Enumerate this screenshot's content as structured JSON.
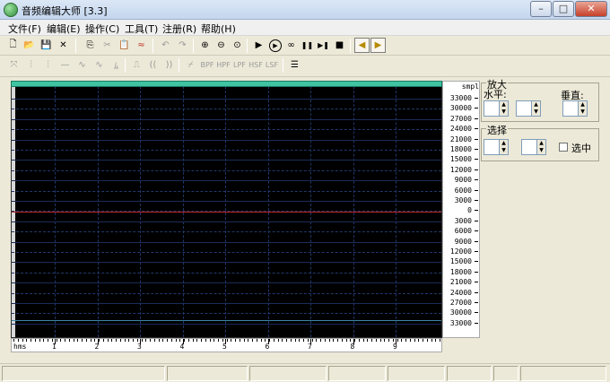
{
  "window": {
    "title": "音频编辑大师 [3.3]",
    "minimize": "–",
    "maximize": "□",
    "close": "✕"
  },
  "menu": {
    "items": [
      "文件(F)",
      "编辑(E)",
      "操作(C)",
      "工具(T)",
      "注册(R)",
      "帮助(H)"
    ]
  },
  "toolbar1": {
    "new": "🗋",
    "open": "📂",
    "save": "💾",
    "close": "✕",
    "copy": "⎘",
    "cut": "✂",
    "paste": "📋",
    "mix": "≈",
    "undo": "↶",
    "redo": "↷",
    "zoom_in": "⊕",
    "zoom_out": "⊖",
    "zoom_fit": "⊙",
    "play": "▶",
    "play_sel": "▶",
    "loop": "∞",
    "pause": "❚❚",
    "play_end": "▶❚",
    "stop": "■",
    "monitor_left": "◀",
    "monitor_right": "▶"
  },
  "toolbar2": {
    "fx": [
      "⤧",
      "⫶",
      "⫶",
      "—",
      "∿",
      "∿",
      "ﾑ",
      "⎍",
      "((",
      "))",
      "⌿"
    ],
    "filters": [
      "BPF",
      "HPF",
      "LPF",
      "HSF",
      "LSF"
    ],
    "settings_icon": "☰"
  },
  "waveform": {
    "yaxis_unit": "smpl",
    "yaxis_labels": [
      "33000",
      "30000",
      "27000",
      "24000",
      "21000",
      "18000",
      "15000",
      "12000",
      "9000",
      "6000",
      "3000",
      "0",
      "3000",
      "6000",
      "9000",
      "12000",
      "15000",
      "18000",
      "21000",
      "24000",
      "27000",
      "30000",
      "33000"
    ],
    "xaxis_unit": "hms",
    "xaxis_labels": [
      "1",
      "2",
      "3",
      "4",
      "5",
      "6",
      "7",
      "8",
      "9"
    ],
    "colors": {
      "background": "#000000",
      "center_line": "#c0252a",
      "grid": "#1f3669",
      "top_bar": "#3fc3a0"
    }
  },
  "zoom_panel": {
    "title": "放大",
    "horizontal_label": "水平:",
    "vertical_label": "垂直:",
    "horizontal_value": "",
    "horizontal_value2": "",
    "vertical_value": ""
  },
  "selection_panel": {
    "title": "选择",
    "start_value": "",
    "end_value": "",
    "checkbox_label": "选中"
  },
  "statusbar": {
    "cells": [
      "",
      "",
      "",
      "",
      "",
      "",
      "",
      ""
    ]
  }
}
